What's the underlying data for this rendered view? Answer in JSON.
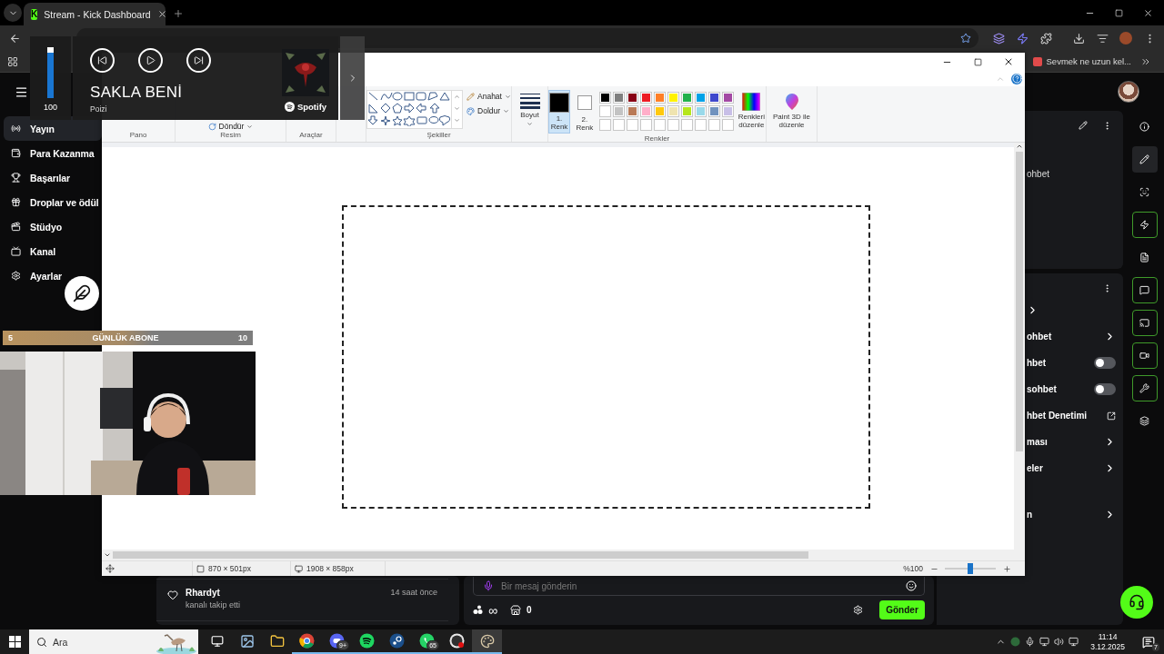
{
  "browser": {
    "tab": {
      "favicon": "K",
      "title": "Stream - Kick Dashboard",
      "selected": true
    },
    "bookmark": "Sevmek ne uzun kel..."
  },
  "media": {
    "volume": {
      "level": 1,
      "reading": "100"
    },
    "title": "SAKLA BENİ",
    "artist": "Poizi",
    "source": "Spotify"
  },
  "paint": {
    "groups": [
      "Pano",
      "Resim",
      "Araçlar",
      "Şekiller",
      "Renkler"
    ],
    "rotate": "Döndür",
    "outline": "Anahat",
    "fill": "Doldur",
    "size": "Boyut",
    "color_slots": [
      {
        "label": "1. Renk",
        "color": "#000000",
        "selected": true
      },
      {
        "label": "2. Renk",
        "color": "#ffffff",
        "selected": false
      }
    ],
    "palette": [
      {
        "color": "#000000"
      },
      {
        "color": "#7f7f7f"
      },
      {
        "color": "#880015"
      },
      {
        "color": "#ed1c24"
      },
      {
        "color": "#ff7f27"
      },
      {
        "color": "#fff200"
      },
      {
        "color": "#22b14c"
      },
      {
        "color": "#00a2e8"
      },
      {
        "color": "#3f48cc"
      },
      {
        "color": "#a349a4"
      },
      {
        "color": "#ffffff"
      },
      {
        "color": "#c3c3c3"
      },
      {
        "color": "#b97a57"
      },
      {
        "color": "#ffaec9"
      },
      {
        "color": "#ffc90e"
      },
      {
        "color": "#efe4b0"
      },
      {
        "color": "#b5e61d"
      },
      {
        "color": "#99d9ea"
      },
      {
        "color": "#7092be"
      },
      {
        "color": "#c8bfe7"
      }
    ],
    "edit_colors": "Renkleri düzenle",
    "paint3d": "Paint 3D ile düzenle",
    "selection_size": "870 × 501px",
    "image_size": "1908 × 858px",
    "zoom": {
      "reading": "%100",
      "level": 0.5
    }
  },
  "kick": {
    "sidebar": [
      {
        "label": "Yayın",
        "selected": true
      },
      {
        "label": "Para Kazanma",
        "selected": false
      },
      {
        "label": "Başarılar",
        "selected": false
      },
      {
        "label": "Droplar ve ödül",
        "selected": false
      },
      {
        "label": "Stüdyo",
        "selected": false
      },
      {
        "label": "Kanal",
        "selected": false
      },
      {
        "label": "Ayarlar",
        "selected": false
      }
    ],
    "activity": {
      "user": "Rhardyt",
      "action": "kanalı takip etti",
      "time": "14 saat önce"
    },
    "chat": {
      "placeholder": "Bir mesaj gönderin",
      "points": "∞",
      "store_count": "0",
      "send": "Gönder"
    },
    "panel_top": {
      "label": "ohbet"
    },
    "settings": [
      {
        "kind": "link"
      },
      {
        "kind": "link",
        "label": "ohbet"
      },
      {
        "kind": "toggle",
        "label": "hbet",
        "on": false
      },
      {
        "kind": "toggle",
        "label": "sohbet",
        "on": false
      },
      {
        "kind": "external",
        "label": "hbet Denetimi"
      },
      {
        "kind": "link",
        "label": "ması"
      },
      {
        "kind": "link",
        "label": "eler"
      },
      {
        "kind": "link",
        "label": "n"
      }
    ],
    "rail": [
      {
        "selected": false,
        "pinned": false
      },
      {
        "selected": true,
        "pinned": false
      },
      {
        "selected": false,
        "pinned": false
      },
      {
        "selected": false,
        "pinned": true
      },
      {
        "selected": false,
        "pinned": false
      },
      {
        "selected": false,
        "pinned": true
      },
      {
        "selected": false,
        "pinned": true
      },
      {
        "selected": false,
        "pinned": true
      },
      {
        "selected": false,
        "pinned": true
      },
      {
        "selected": false,
        "pinned": false
      }
    ]
  },
  "overlay": {
    "sub_goal": {
      "current": "5",
      "label": "GÜNLÜK ABONE",
      "target": "10",
      "level": 0.6
    }
  },
  "taskbar": {
    "search": {
      "placeholder": "Ara"
    },
    "apps": [
      {
        "running": false,
        "selected": false
      },
      {
        "running": false,
        "selected": false
      },
      {
        "running": true,
        "selected": false
      },
      {
        "running": true,
        "selected": false,
        "badge": "9+"
      },
      {
        "running": true,
        "selected": false
      },
      {
        "running": true,
        "selected": false
      },
      {
        "running": true,
        "selected": false,
        "badge": "65"
      },
      {
        "running": true,
        "selected": false
      },
      {
        "running": true,
        "selected": true
      }
    ],
    "time": "11:14",
    "date": "3.12.2025",
    "notifications": "7"
  }
}
